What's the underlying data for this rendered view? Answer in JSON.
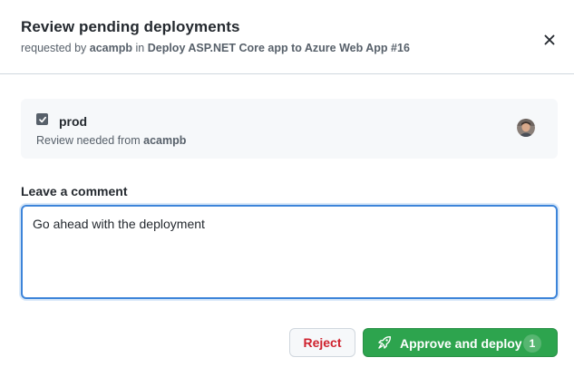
{
  "dialog": {
    "title": "Review pending deployments",
    "subtitle": {
      "prefix": "requested by",
      "user": "acampb",
      "middle": "in",
      "workflow": "Deploy ASP.NET Core app to Azure Web App #16"
    }
  },
  "environment": {
    "name": "prod",
    "checked": true,
    "review_prefix": "Review needed from",
    "reviewer": "acampb"
  },
  "comment": {
    "label": "Leave a comment",
    "value": "Go ahead with the deployment"
  },
  "actions": {
    "reject_label": "Reject",
    "approve_label": "Approve and deploy",
    "approve_count": "1"
  },
  "colors": {
    "approve": "#2da44e",
    "reject_text": "#cf222e",
    "focus_border": "#3c84d9"
  },
  "icons": {
    "close": "close-icon",
    "checkbox": "checkbox-checked-icon",
    "approve": "rocket-icon",
    "avatar": "user-avatar"
  }
}
